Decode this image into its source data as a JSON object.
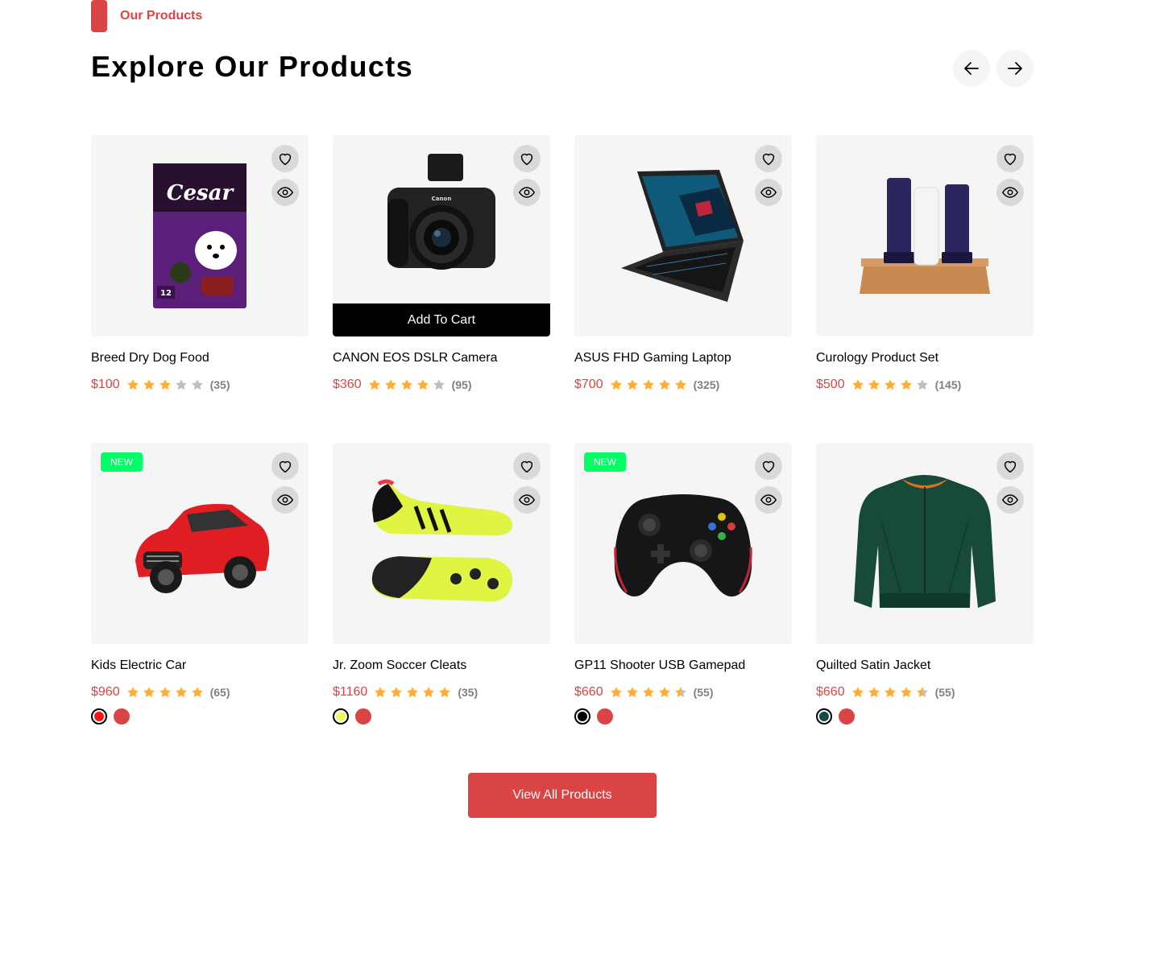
{
  "section": {
    "tag": "Our Products",
    "title": "Explore Our Products",
    "prev_icon": "arrow-left-icon",
    "next_icon": "arrow-right-icon"
  },
  "colors": {
    "accent": "#DB4444",
    "badge_new": "#00FF66",
    "star_filled": "#FFAD33",
    "star_empty": "#BFBFBF",
    "card_bg": "#F5F5F5"
  },
  "products": [
    {
      "name": "Breed Dry Dog Food",
      "price": "$100",
      "rating": 3,
      "reviews": "(35)",
      "image": "dog-food-bag-image"
    },
    {
      "name": "CANON EOS DSLR Camera",
      "price": "$360",
      "rating": 4,
      "reviews": "(95)",
      "add_to_cart": "Add To Cart",
      "image": "dslr-camera-image"
    },
    {
      "name": "ASUS FHD Gaming Laptop",
      "price": "$700",
      "rating": 5,
      "reviews": "(325)",
      "image": "gaming-laptop-image"
    },
    {
      "name": "Curology Product Set",
      "price": "$500",
      "rating": 4,
      "reviews": "(145)",
      "image": "skincare-set-image"
    },
    {
      "name": "Kids Electric Car",
      "price": "$960",
      "rating": 5,
      "reviews": "(65)",
      "badge": "NEW",
      "colors": [
        "#FB1314",
        "#DB4444"
      ],
      "image": "electric-car-image"
    },
    {
      "name": "Jr. Zoom Soccer Cleats",
      "price": "$1160",
      "rating": 5,
      "reviews": "(35)",
      "colors": [
        "#EEFF61",
        "#DB4444"
      ],
      "image": "soccer-cleats-image"
    },
    {
      "name": "GP11 Shooter USB Gamepad",
      "price": "$660",
      "rating": 4.5,
      "reviews": "(55)",
      "badge": "NEW",
      "colors": [
        "#000000",
        "#DB4444"
      ],
      "image": "gamepad-image"
    },
    {
      "name": "Quilted Satin Jacket",
      "price": "$660",
      "rating": 4.5,
      "reviews": "(55)",
      "colors": [
        "#184A48",
        "#DB4444"
      ],
      "image": "satin-jacket-image"
    }
  ],
  "view_all": "View All Products"
}
